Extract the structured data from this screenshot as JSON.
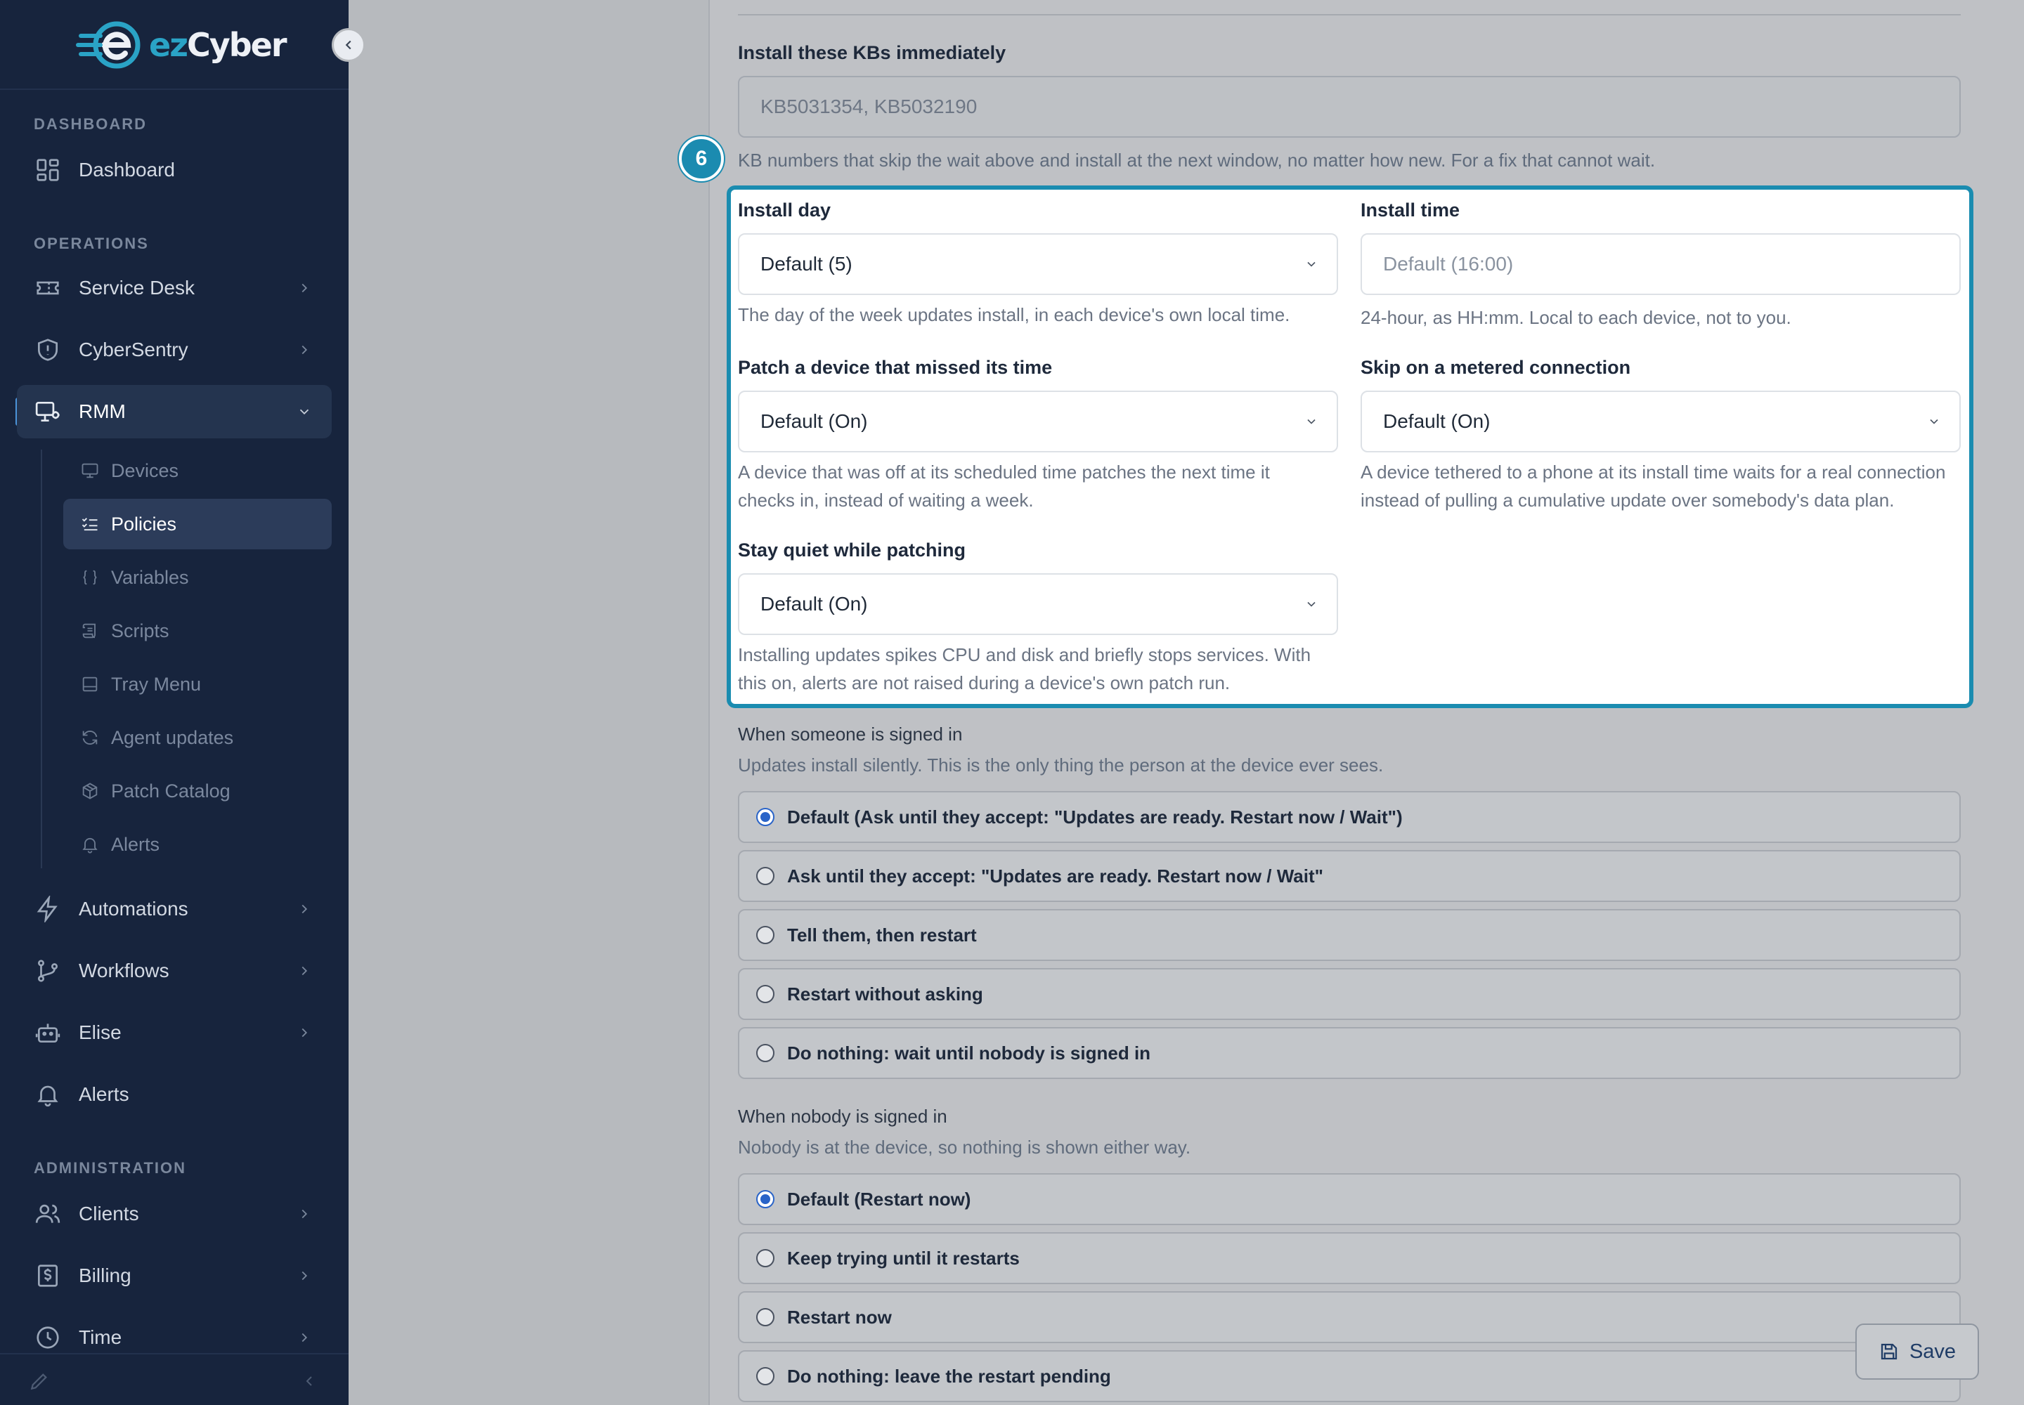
{
  "brand": {
    "name_part1": "ez",
    "name_part2": "Cyber",
    "accent": "#2aa3c6"
  },
  "sidebar": {
    "sections": {
      "dashboard": "DASHBOARD",
      "operations": "OPERATIONS",
      "administration": "ADMINISTRATION"
    },
    "items": {
      "dashboard": "Dashboard",
      "service_desk": "Service Desk",
      "cybersentry": "CyberSentry",
      "rmm": "RMM",
      "automations": "Automations",
      "workflows": "Workflows",
      "elise": "Elise",
      "alerts": "Alerts",
      "clients": "Clients",
      "billing": "Billing",
      "time": "Time"
    },
    "rmm_sub": {
      "devices": "Devices",
      "policies": "Policies",
      "variables": "Variables",
      "scripts": "Scripts",
      "tray_menu": "Tray Menu",
      "agent_updates": "Agent updates",
      "patch_catalog": "Patch Catalog",
      "alerts": "Alerts"
    }
  },
  "form": {
    "kbs": {
      "label": "Install these KBs immediately",
      "placeholder": "KB5031354, KB5032190",
      "help": "KB numbers that skip the wait above and install at the next window, no matter how new. For a fix that cannot wait."
    },
    "step_badge": "6",
    "install_day": {
      "label": "Install day",
      "value": "Default (5)",
      "help": "The day of the week updates install, in each device's own local time."
    },
    "install_time": {
      "label": "Install time",
      "placeholder": "Default (16:00)",
      "help": "24-hour, as HH:mm. Local to each device, not to you."
    },
    "missed": {
      "label": "Patch a device that missed its time",
      "value": "Default (On)",
      "help1": "A device that was off at its scheduled time patches the next time it",
      "help2": "checks in, instead of waiting a week."
    },
    "metered": {
      "label": "Skip on a metered connection",
      "value": "Default (On)",
      "help1": "A device tethered to a phone at its install time waits for a real connection",
      "help2": "instead of pulling a cumulative update over somebody's data plan."
    },
    "quiet": {
      "label": "Stay quiet while patching",
      "value": "Default (On)",
      "help1": "Installing updates spikes CPU and disk and briefly stops services. With",
      "help2": "this on, alerts are not raised during a device's own patch run."
    },
    "signed_in": {
      "label": "When someone is signed in",
      "help": "Updates install silently. This is the only thing the person at the device ever sees.",
      "options": [
        "Default (Ask until they accept: \"Updates are ready. Restart now / Wait\")",
        "Ask until they accept: \"Updates are ready. Restart now / Wait\"",
        "Tell them, then restart",
        "Restart without asking",
        "Do nothing: wait until nobody is signed in"
      ]
    },
    "nobody": {
      "label": "When nobody is signed in",
      "help": "Nobody is at the device, so nothing is shown either way.",
      "options": [
        "Default (Restart now)",
        "Keep trying until it restarts",
        "Restart now",
        "Do nothing: leave the restart pending"
      ]
    }
  },
  "save_label": "Save"
}
